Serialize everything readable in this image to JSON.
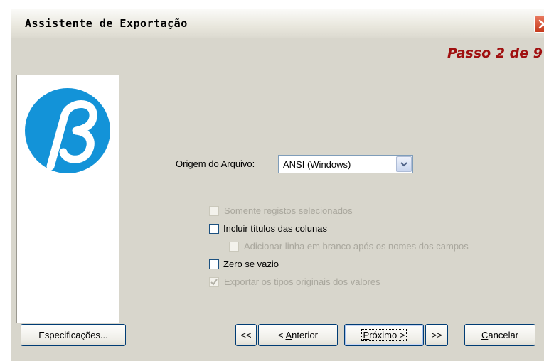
{
  "window": {
    "title": "Assistente de Exportação",
    "step": "Passo 2 de 9"
  },
  "form": {
    "origin_label": "Origem do Arquivo:",
    "origin_value": "ANSI (Windows)"
  },
  "options": [
    {
      "label": "Somente registos selecionados",
      "checked": false,
      "enabled": false
    },
    {
      "label": "Incluir títulos das colunas",
      "checked": false,
      "enabled": true
    },
    {
      "label": "Adicionar linha em branco após os nomes dos campos",
      "checked": false,
      "enabled": false
    },
    {
      "label": "Zero se vazio",
      "checked": false,
      "enabled": true
    },
    {
      "label": "Exportar os tipos originais dos valores",
      "checked": true,
      "enabled": false
    }
  ],
  "buttons": {
    "specs": "Especificações...",
    "first": "<<",
    "prev_prefix": "< ",
    "prev_accel": "A",
    "prev_rest": "nterior",
    "next_accel": "P",
    "next_rest": "róximo >",
    "last": ">>",
    "cancel_accel": "C",
    "cancel_rest": "ancelar"
  },
  "icons": {
    "logo": "beta-logo",
    "close": "close-icon",
    "dropdown": "chevron-down-icon",
    "check": "checkmark-icon"
  },
  "colors": {
    "step_text": "#a01010",
    "logo_blue": "#1393d8",
    "close_red": "#c5391b"
  }
}
